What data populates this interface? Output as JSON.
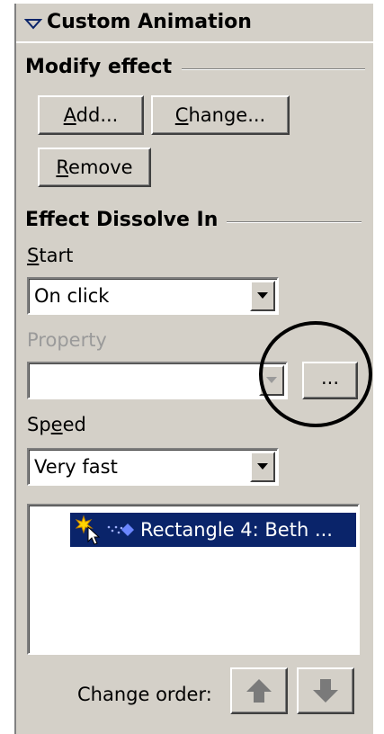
{
  "panel": {
    "title": "Custom Animation"
  },
  "modify": {
    "heading": "Modify effect",
    "add_prefix": "A",
    "add_rest": "dd...",
    "change_prefix": "C",
    "change_rest": "hange...",
    "remove_prefix": "R",
    "remove_rest": "emove"
  },
  "effect": {
    "heading": "Effect Dissolve In",
    "start_prefix": "S",
    "start_rest": "tart",
    "start_value": "On click",
    "property_label": "Property",
    "property_value": "",
    "more_button": "...",
    "speed_prefix": "Sp",
    "speed_u": "e",
    "speed_rest": "ed",
    "speed_value": "Very fast"
  },
  "list": {
    "items": [
      {
        "label": "Rectangle 4:  Beth ..."
      }
    ]
  },
  "order": {
    "label": "Change order:"
  }
}
